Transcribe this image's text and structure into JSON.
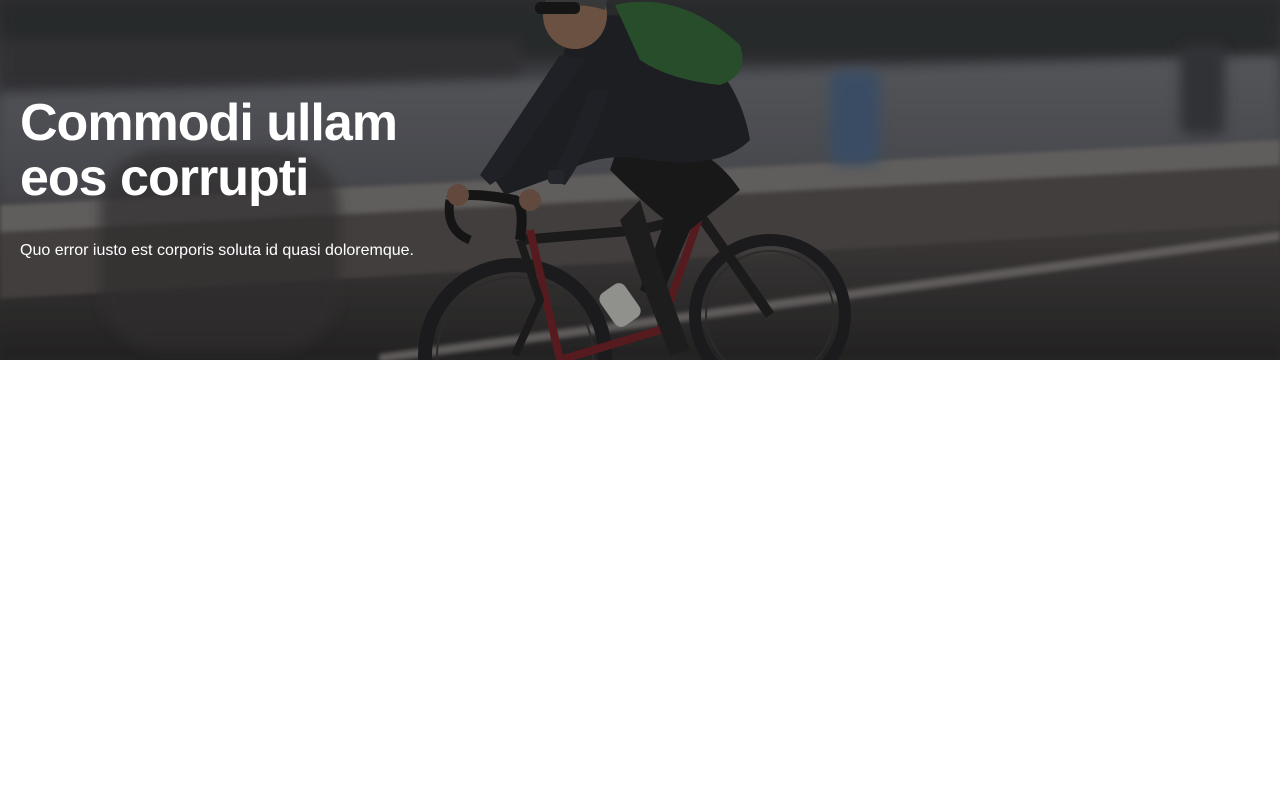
{
  "hero": {
    "title": "Commodi ullam eos corrupti",
    "subtitle": "Quo error iusto est corporis soluta id quasi doloremque.",
    "image": "cyclist-riding-road-bike-photo"
  },
  "colors": {
    "hero_overlay": "#2a2a2c",
    "text": "#ffffff",
    "page_background": "#ffffff"
  }
}
